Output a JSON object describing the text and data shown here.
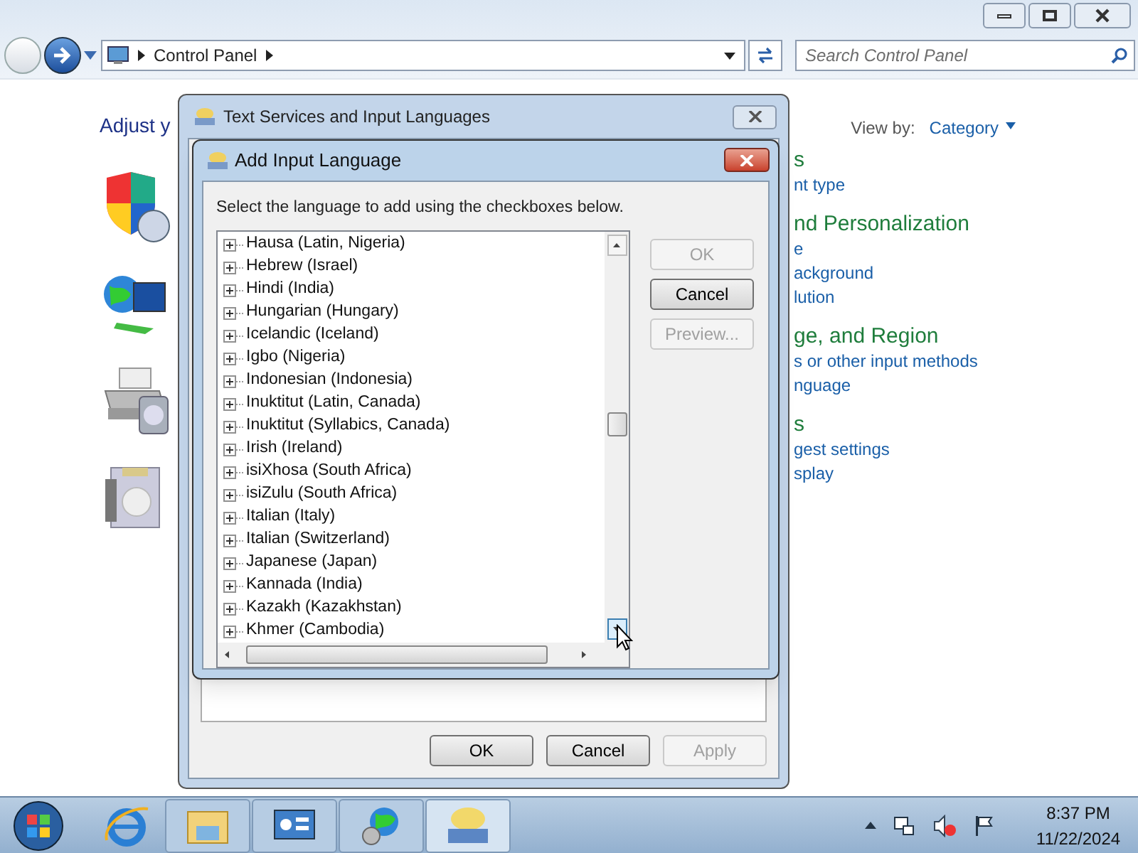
{
  "explorer": {
    "address": [
      "Control Panel"
    ],
    "search": {
      "placeholder": "Search Control Panel"
    },
    "heading": "Adjust y",
    "view_by": {
      "label": "View by:",
      "value": "Category"
    },
    "right_items": [
      {
        "kind": "heading",
        "text": "s"
      },
      {
        "kind": "link",
        "text": "nt type"
      },
      {
        "kind": "heading",
        "text": "nd Personalization"
      },
      {
        "kind": "link",
        "text": "e"
      },
      {
        "kind": "link",
        "text": "ackground"
      },
      {
        "kind": "link",
        "text": "lution"
      },
      {
        "kind": "heading",
        "text": "ge, and Region"
      },
      {
        "kind": "link",
        "text": "s or other input methods"
      },
      {
        "kind": "link",
        "text": "nguage"
      },
      {
        "kind": "heading",
        "text": "s"
      },
      {
        "kind": "link",
        "text": "gest settings"
      },
      {
        "kind": "link",
        "text": "splay"
      }
    ]
  },
  "text_services": {
    "title": "Text Services and Input Languages",
    "buttons": [
      {
        "label": "OK",
        "disabled": false
      },
      {
        "label": "Cancel",
        "disabled": false
      },
      {
        "label": "Apply",
        "disabled": true
      }
    ]
  },
  "add_language": {
    "title": "Add Input Language",
    "instruction": "Select the language to add using the checkboxes below.",
    "languages": [
      {
        "label": "Hausa (Latin, Nigeria)",
        "expanded": false
      },
      {
        "label": "Hebrew (Israel)",
        "expanded": false
      },
      {
        "label": "Hindi (India)",
        "expanded": false
      },
      {
        "label": "Hungarian (Hungary)",
        "expanded": false
      },
      {
        "label": "Icelandic (Iceland)",
        "expanded": false
      },
      {
        "label": "Igbo (Nigeria)",
        "expanded": false
      },
      {
        "label": "Indonesian (Indonesia)",
        "expanded": false
      },
      {
        "label": "Inuktitut (Latin, Canada)",
        "expanded": false
      },
      {
        "label": "Inuktitut (Syllabics, Canada)",
        "expanded": false
      },
      {
        "label": "Irish (Ireland)",
        "expanded": false
      },
      {
        "label": "isiXhosa (South Africa)",
        "expanded": false
      },
      {
        "label": "isiZulu (South Africa)",
        "expanded": false
      },
      {
        "label": "Italian (Italy)",
        "expanded": false
      },
      {
        "label": "Italian (Switzerland)",
        "expanded": false
      },
      {
        "label": "Japanese (Japan)",
        "expanded": false
      },
      {
        "label": "Kannada (India)",
        "expanded": false
      },
      {
        "label": "Kazakh (Kazakhstan)",
        "expanded": false
      },
      {
        "label": "Khmer (Cambodia)",
        "expanded": false
      }
    ],
    "buttons": [
      {
        "label": "OK",
        "disabled": true
      },
      {
        "label": "Cancel",
        "disabled": false
      },
      {
        "label": "Preview...",
        "disabled": true
      }
    ]
  },
  "taskbar": {
    "time": "8:37 PM",
    "date": "11/22/2024"
  }
}
